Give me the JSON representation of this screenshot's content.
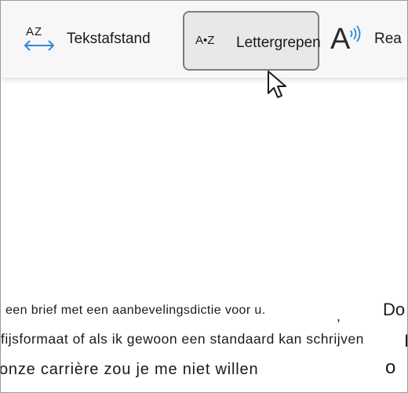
{
  "toolbar": {
    "text_spacing": {
      "icon_text": "AZ",
      "label": "Tekstafstand"
    },
    "syllables": {
      "icon_text": "A•Z",
      "label": "Lettergrepen",
      "selected": true
    },
    "read_aloud": {
      "icon_text": "A",
      "label": "Rea"
    },
    "colors": {
      "accent": "#2b88d8",
      "selected_bg": "#e8e8e8",
      "toolbar_bg": "#f7f7f7"
    }
  },
  "document": {
    "lines": [
      "een brief met een aanbevelingsdictie voor u.",
      "fijsformaat of als ik gewoon een standaard kan schrijven",
      "onze carrière zou je me niet willen"
    ],
    "right_fragments": [
      "Do",
      "I",
      "o"
    ]
  }
}
